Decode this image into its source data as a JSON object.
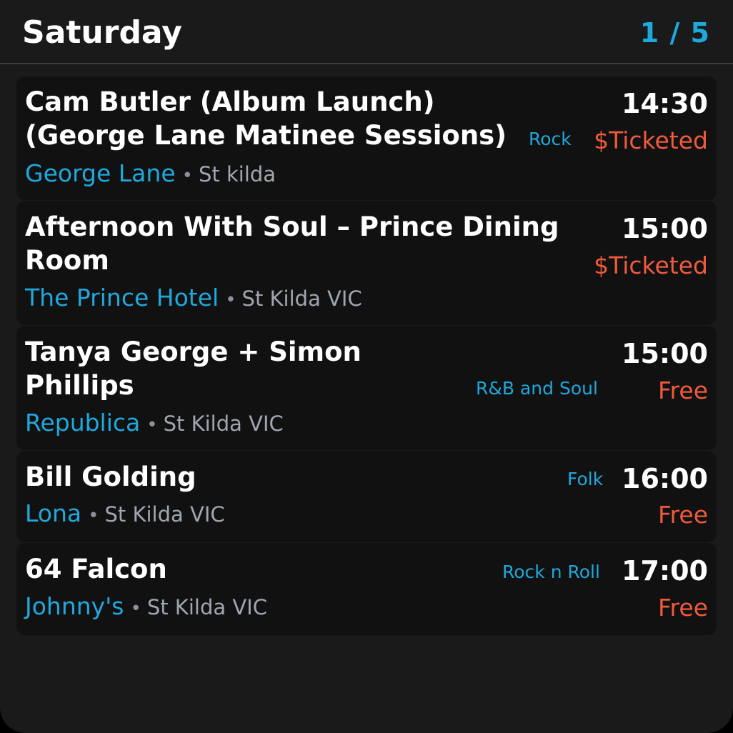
{
  "header": {
    "day": "Saturday",
    "page": "1 / 5"
  },
  "events": [
    {
      "title_lines": [
        "Cam Butler (Album Launch)",
        "(George Lane Matinee Sessions)"
      ],
      "genre": "Rock",
      "time": "14:30",
      "price": "$Ticketed",
      "venue": "George Lane",
      "separator": "•",
      "suburb": "St kilda"
    },
    {
      "title_lines": [
        "Afternoon With Soul – Prince Dining",
        "Room"
      ],
      "genre": "",
      "time": "15:00",
      "price": "$Ticketed",
      "venue": "The Prince Hotel",
      "separator": "•",
      "suburb": "St Kilda VIC"
    },
    {
      "title_lines": [
        "Tanya George + Simon",
        "Phillips"
      ],
      "genre": "R&B and Soul",
      "time": "15:00",
      "price": "Free",
      "venue": "Republica",
      "separator": "•",
      "suburb": "St Kilda VIC"
    },
    {
      "title_lines": [
        "Bill Golding"
      ],
      "genre": "Folk",
      "time": "16:00",
      "price": "Free",
      "venue": "Lona",
      "separator": "•",
      "suburb": "St Kilda VIC"
    },
    {
      "title_lines": [
        "64 Falcon"
      ],
      "genre": "Rock n Roll",
      "time": "17:00",
      "price": "Free",
      "venue": "Johnny's",
      "separator": "•",
      "suburb": "St Kilda VIC"
    }
  ],
  "colors": {
    "background": "#1a1a1a",
    "card": "#111111",
    "accent": "#1fa8dc",
    "price": "#f05a3c",
    "title": "#ffffff",
    "muted": "#a0a6b0"
  }
}
